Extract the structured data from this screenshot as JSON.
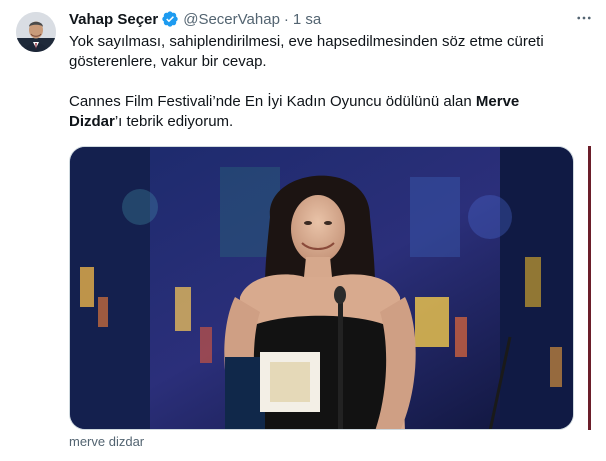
{
  "tweet": {
    "author_name": "Vahap Seçer",
    "handle": "@SecerVahap",
    "separator": "·",
    "time": "1 sa",
    "more_label": "···",
    "text_line1": "Yok sayılması, sahiplendirilmesi, eve hapsedilmesinden söz etme cüreti gösterenlere, vakur bir cevap.",
    "text_line2_prefix": "Cannes Film Festivali’nde En İyi Kadın Oyuncu ödülünü alan ",
    "text_line2_bold": "Merve Dizdar",
    "text_line2_suffix": "’ı tebrik ediyorum.",
    "media_caption": "merve dizdar"
  },
  "colors": {
    "verified_badge": "#1d9bf0",
    "secondary_text": "#536471",
    "primary_text": "#0f1419"
  },
  "icons": {
    "verified": "verified-badge-icon",
    "more": "more-options-icon"
  }
}
